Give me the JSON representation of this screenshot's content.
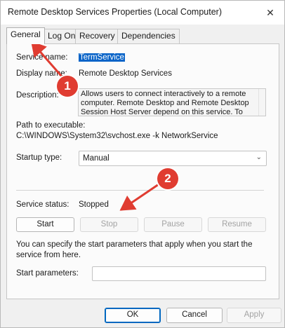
{
  "window": {
    "title": "Remote Desktop Services Properties (Local Computer)",
    "close_glyph": "✕"
  },
  "tabs": [
    {
      "label": "General",
      "active": true
    },
    {
      "label": "Log On",
      "active": false
    },
    {
      "label": "Recovery",
      "active": false
    },
    {
      "label": "Dependencies",
      "active": false
    }
  ],
  "general": {
    "service_name_label": "Service name:",
    "service_name_value": "TermService",
    "display_name_label": "Display name:",
    "display_name_value": "Remote Desktop Services",
    "description_label": "Description:",
    "description_value": "Allows users to connect interactively to a remote computer. Remote Desktop and Remote Desktop Session Host Server depend on this service.  To",
    "path_label": "Path to executable:",
    "path_value": "C:\\WINDOWS\\System32\\svchost.exe -k NetworkService",
    "startup_type_label": "Startup type:",
    "startup_type_value": "Manual",
    "service_status_label": "Service status:",
    "service_status_value": "Stopped",
    "start_label": "Start",
    "stop_label": "Stop",
    "pause_label": "Pause",
    "resume_label": "Resume",
    "hint": "You can specify the start parameters that apply when you start the service from here.",
    "start_params_label": "Start parameters:",
    "start_params_value": ""
  },
  "footer": {
    "ok_label": "OK",
    "cancel_label": "Cancel",
    "apply_label": "Apply"
  },
  "annotations": [
    {
      "number": "1"
    },
    {
      "number": "2"
    }
  ],
  "colors": {
    "annotation": "#e03c31",
    "selection": "#0a64c8",
    "primary_border": "#0067c0"
  }
}
